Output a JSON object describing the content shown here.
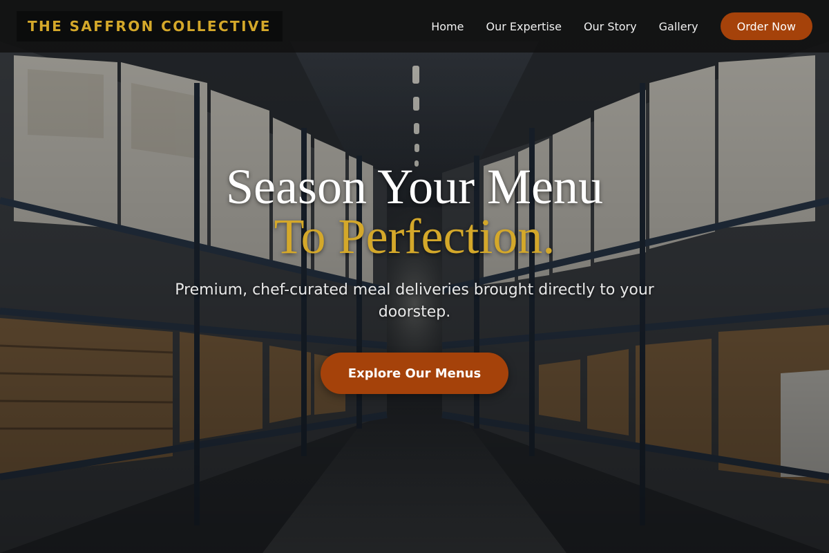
{
  "navbar": {
    "brand": "THE SAFFRON COLLECTIVE",
    "links": [
      "Home",
      "Our Expertise",
      "Our Story",
      "Gallery"
    ],
    "order_label": "Order Now"
  },
  "hero": {
    "headline_line1": "Season Your Menu",
    "headline_line2": "To Perfection.",
    "subtitle": "Premium, chef-curated meal deliveries brought directly to your doorstep.",
    "cta_label": "Explore Our Menus"
  },
  "colors": {
    "accent_gold": "#d4a82a",
    "button_orange": "#a5420a",
    "nav_background": "#121212"
  },
  "background": {
    "subject": "warehouse-aisle-photo"
  }
}
